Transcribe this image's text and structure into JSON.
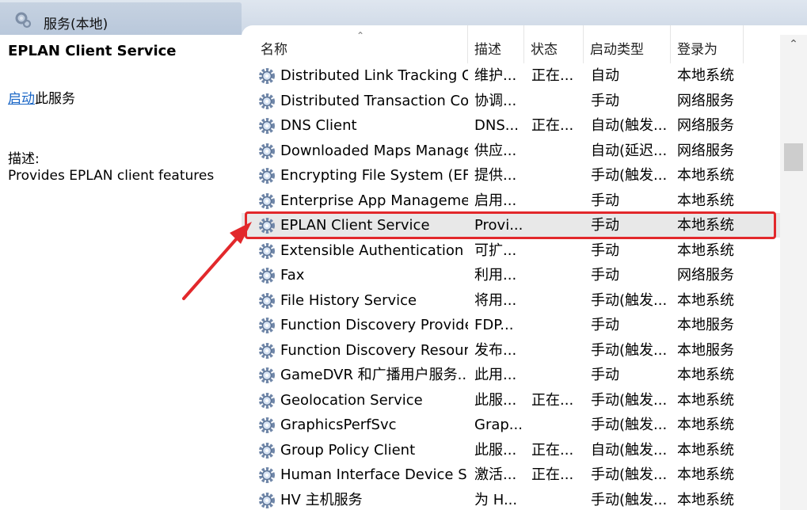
{
  "header": {
    "tab_title": "服务(本地)"
  },
  "left_panel": {
    "service_name": "EPLAN Client Service",
    "start_link": "启动",
    "start_suffix": "此服务",
    "desc_label": "描述:",
    "desc_text": "Provides EPLAN client features"
  },
  "columns": {
    "name": "名称",
    "desc": "描述",
    "status": "状态",
    "startup": "启动类型",
    "logon": "登录为"
  },
  "rows": [
    {
      "name": "Distributed Link Tracking C...",
      "desc": "维护...",
      "status": "正在...",
      "startup": "自动",
      "logon": "本地系统"
    },
    {
      "name": "Distributed Transaction Co...",
      "desc": "协调...",
      "status": "",
      "startup": "手动",
      "logon": "网络服务"
    },
    {
      "name": "DNS Client",
      "desc": "DNS...",
      "status": "正在...",
      "startup": "自动(触发...",
      "logon": "网络服务"
    },
    {
      "name": "Downloaded Maps Manager",
      "desc": "供应...",
      "status": "",
      "startup": "自动(延迟...",
      "logon": "网络服务"
    },
    {
      "name": "Encrypting File System (EFS)",
      "desc": "提供...",
      "status": "",
      "startup": "手动(触发...",
      "logon": "本地系统"
    },
    {
      "name": "Enterprise App Manageme...",
      "desc": "启用...",
      "status": "",
      "startup": "手动",
      "logon": "本地系统"
    },
    {
      "name": "EPLAN Client Service",
      "desc": "Provi...",
      "status": "",
      "startup": "手动",
      "logon": "本地系统"
    },
    {
      "name": "Extensible Authentication ...",
      "desc": "可扩...",
      "status": "",
      "startup": "手动",
      "logon": "本地系统"
    },
    {
      "name": "Fax",
      "desc": "利用...",
      "status": "",
      "startup": "手动",
      "logon": "网络服务"
    },
    {
      "name": "File History Service",
      "desc": "将用...",
      "status": "",
      "startup": "手动(触发...",
      "logon": "本地系统"
    },
    {
      "name": "Function Discovery Provide...",
      "desc": "FDP...",
      "status": "",
      "startup": "手动",
      "logon": "本地服务"
    },
    {
      "name": "Function Discovery Resour...",
      "desc": "发布...",
      "status": "",
      "startup": "手动(触发...",
      "logon": "本地服务"
    },
    {
      "name": "GameDVR 和广播用户服务...",
      "desc": "此用...",
      "status": "",
      "startup": "手动",
      "logon": "本地系统"
    },
    {
      "name": "Geolocation Service",
      "desc": "此服...",
      "status": "正在...",
      "startup": "手动(触发...",
      "logon": "本地系统"
    },
    {
      "name": "GraphicsPerfSvc",
      "desc": "Grap...",
      "status": "",
      "startup": "手动(触发...",
      "logon": "本地系统"
    },
    {
      "name": "Group Policy Client",
      "desc": "此服...",
      "status": "正在...",
      "startup": "自动(触发...",
      "logon": "本地系统"
    },
    {
      "name": "Human Interface Device S...",
      "desc": "激活...",
      "status": "正在...",
      "startup": "手动(触发...",
      "logon": "本地系统"
    },
    {
      "name": "HV 主机服务",
      "desc": "为 H...",
      "status": "",
      "startup": "手动(触发...",
      "logon": "本地系统"
    }
  ],
  "selected_index": 6,
  "icons": {
    "row": "gear-service-icon",
    "tab": "services-gear-icon"
  },
  "colors": {
    "highlight": "#e2282b",
    "link": "#1a66c6",
    "selected_row": "#e8e8e8"
  }
}
